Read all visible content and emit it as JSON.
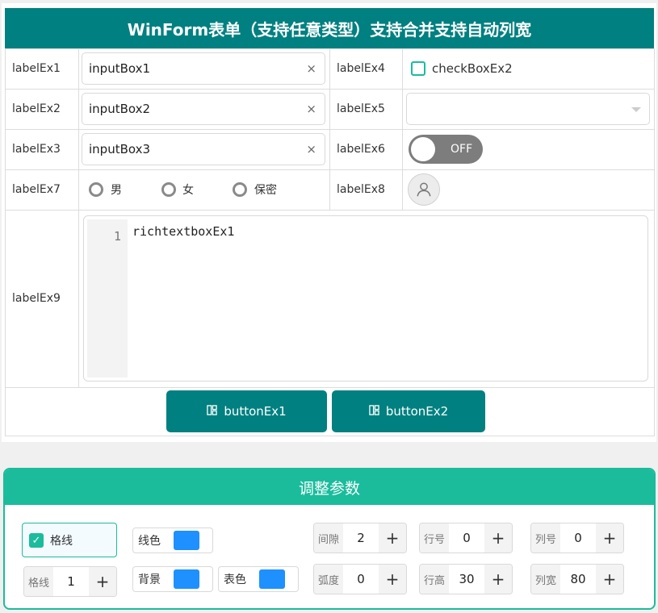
{
  "form": {
    "title": "WinForm表单（支持任意类型）支持合并支持自动列宽",
    "labels": {
      "l1": "labelEx1",
      "l2": "labelEx2",
      "l3": "labelEx3",
      "l4": "labelEx4",
      "l5": "labelEx5",
      "l6": "labelEx6",
      "l7": "labelEx7",
      "l8": "labelEx8",
      "l9": "labelEx9"
    },
    "inputs": {
      "input1": "inputBox1",
      "input2": "inputBox2",
      "input3": "inputBox3",
      "clear_glyph": "×"
    },
    "checkbox2": {
      "label": "checkBoxEx2",
      "checked": false
    },
    "select5": {
      "value": ""
    },
    "switch6": {
      "text": "OFF",
      "on": false
    },
    "radios": [
      "男",
      "女",
      "保密"
    ],
    "avatar_icon": "user-icon",
    "rich": {
      "line_number": "1",
      "text": "richtextboxEx1"
    },
    "buttons": {
      "b1": "buttonEx1",
      "b2": "buttonEx2",
      "icon": "grid-icon"
    }
  },
  "params": {
    "title": "调整参数",
    "grid_check": {
      "label": "格线",
      "checked": true
    },
    "line_color": {
      "label": "线色",
      "color": "#1e90ff"
    },
    "background": {
      "label": "背景",
      "color": "#1e90ff"
    },
    "table_color": {
      "label": "表色",
      "color": "#1e90ff"
    },
    "steppers": {
      "grid": {
        "label": "格线",
        "value": "1"
      },
      "gap": {
        "label": "间隙",
        "value": "2"
      },
      "radius": {
        "label": "弧度",
        "value": "0"
      },
      "row_no": {
        "label": "行号",
        "value": "0"
      },
      "row_height": {
        "label": "行高",
        "value": "30"
      },
      "col_no": {
        "label": "列号",
        "value": "0"
      },
      "col_width": {
        "label": "列宽",
        "value": "80"
      }
    },
    "plus_glyph": "+"
  },
  "colors": {
    "teal": "#008080",
    "accent": "#1abc9c",
    "swatch": "#1e90ff",
    "switch_off": "#7d7d7d"
  }
}
